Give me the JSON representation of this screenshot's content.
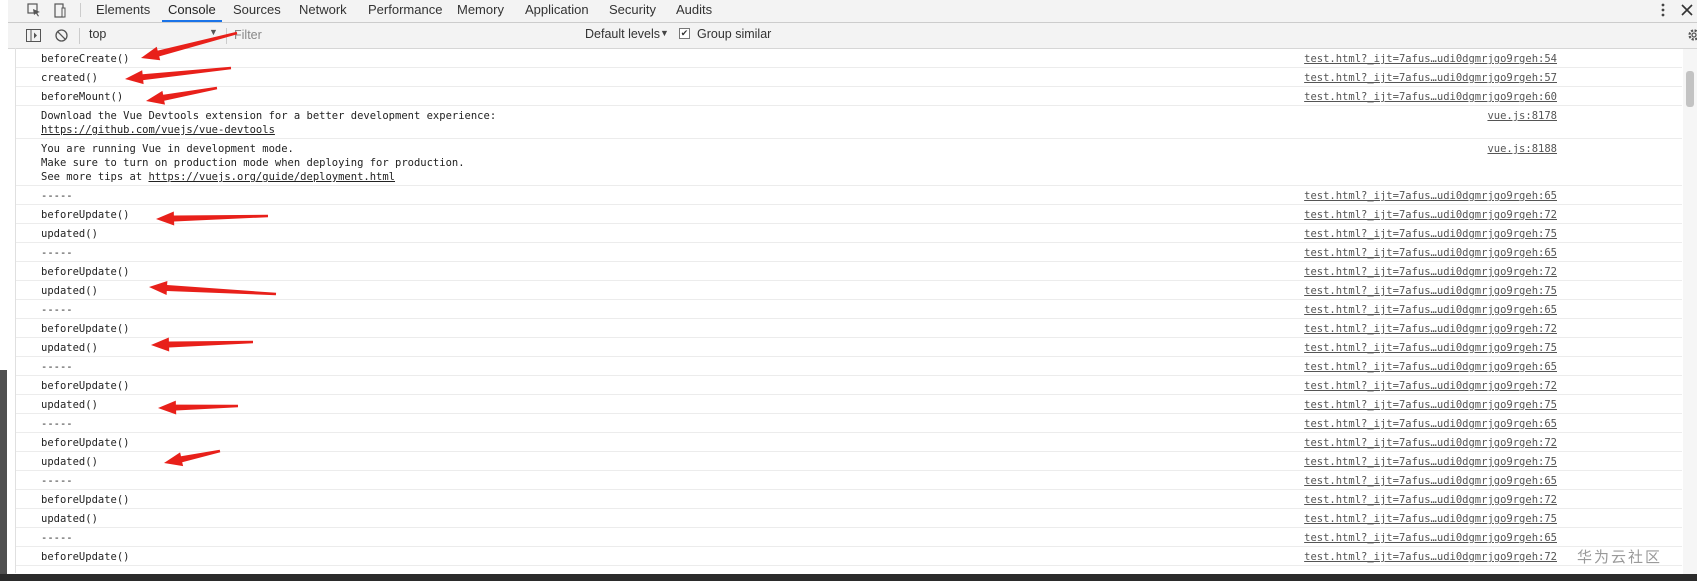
{
  "devtools": {
    "tabs": [
      "Elements",
      "Console",
      "Sources",
      "Network",
      "Performance",
      "Memory",
      "Application",
      "Security",
      "Audits"
    ],
    "active_tab": "Console"
  },
  "console_toolbar": {
    "context": "top",
    "filter_placeholder": "Filter",
    "levels": "Default levels",
    "group_similar": "Group similar",
    "group_similar_checked": true
  },
  "messages": [
    {
      "lines": [
        "beforeCreate()"
      ],
      "source": "test.html?_ijt=7afus…udi0dgmrjgo9rgeh:54"
    },
    {
      "lines": [
        "created()"
      ],
      "source": "test.html?_ijt=7afus…udi0dgmrjgo9rgeh:57"
    },
    {
      "lines": [
        "beforeMount()"
      ],
      "source": "test.html?_ijt=7afus…udi0dgmrjgo9rgeh:60"
    },
    {
      "lines": [
        "Download the Vue Devtools extension for a better development experience:"
      ],
      "link": "https://github.com/vuejs/vue-devtools",
      "source": "vue.js:8178"
    },
    {
      "lines": [
        "You are running Vue in development mode.",
        "Make sure to turn on production mode when deploying for production."
      ],
      "prefix": "See more tips at ",
      "link": "https://vuejs.org/guide/deployment.html",
      "source": "vue.js:8188"
    },
    {
      "lines": [
        "-----"
      ],
      "source": "test.html?_ijt=7afus…udi0dgmrjgo9rgeh:65"
    },
    {
      "lines": [
        "beforeUpdate()"
      ],
      "source": "test.html?_ijt=7afus…udi0dgmrjgo9rgeh:72"
    },
    {
      "lines": [
        "updated()"
      ],
      "source": "test.html?_ijt=7afus…udi0dgmrjgo9rgeh:75"
    },
    {
      "lines": [
        "-----"
      ],
      "source": "test.html?_ijt=7afus…udi0dgmrjgo9rgeh:65"
    },
    {
      "lines": [
        "beforeUpdate()"
      ],
      "source": "test.html?_ijt=7afus…udi0dgmrjgo9rgeh:72"
    },
    {
      "lines": [
        "updated()"
      ],
      "source": "test.html?_ijt=7afus…udi0dgmrjgo9rgeh:75"
    },
    {
      "lines": [
        "-----"
      ],
      "source": "test.html?_ijt=7afus…udi0dgmrjgo9rgeh:65"
    },
    {
      "lines": [
        "beforeUpdate()"
      ],
      "source": "test.html?_ijt=7afus…udi0dgmrjgo9rgeh:72"
    },
    {
      "lines": [
        "updated()"
      ],
      "source": "test.html?_ijt=7afus…udi0dgmrjgo9rgeh:75"
    },
    {
      "lines": [
        "-----"
      ],
      "source": "test.html?_ijt=7afus…udi0dgmrjgo9rgeh:65"
    },
    {
      "lines": [
        "beforeUpdate()"
      ],
      "source": "test.html?_ijt=7afus…udi0dgmrjgo9rgeh:72"
    },
    {
      "lines": [
        "updated()"
      ],
      "source": "test.html?_ijt=7afus…udi0dgmrjgo9rgeh:75"
    },
    {
      "lines": [
        "-----"
      ],
      "source": "test.html?_ijt=7afus…udi0dgmrjgo9rgeh:65"
    },
    {
      "lines": [
        "beforeUpdate()"
      ],
      "source": "test.html?_ijt=7afus…udi0dgmrjgo9rgeh:72"
    },
    {
      "lines": [
        "updated()"
      ],
      "source": "test.html?_ijt=7afus…udi0dgmrjgo9rgeh:75"
    },
    {
      "lines": [
        "-----"
      ],
      "source": "test.html?_ijt=7afus…udi0dgmrjgo9rgeh:65"
    },
    {
      "lines": [
        "beforeUpdate()"
      ],
      "source": "test.html?_ijt=7afus…udi0dgmrjgo9rgeh:72"
    },
    {
      "lines": [
        "updated()"
      ],
      "source": "test.html?_ijt=7afus…udi0dgmrjgo9rgeh:75"
    },
    {
      "lines": [
        "-----"
      ],
      "source": "test.html?_ijt=7afus…udi0dgmrjgo9rgeh:65"
    },
    {
      "lines": [
        "beforeUpdate()"
      ],
      "source": "test.html?_ijt=7afus…udi0dgmrjgo9rgeh:72"
    }
  ],
  "watermark": "华为云社区",
  "annotation_color": "#e8201a"
}
